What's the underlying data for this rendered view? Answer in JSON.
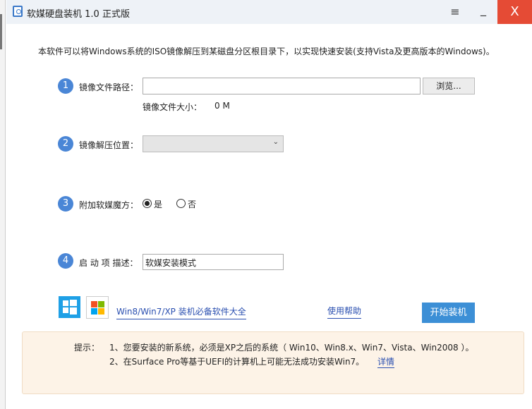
{
  "window": {
    "title": "软媒硬盘装机 1.0 正式版",
    "menu_icon": "hamburger-icon",
    "minimize_icon": "minimize-icon",
    "close_icon": "close-icon",
    "menu_glyph": "≡",
    "min_glyph": "_",
    "close_glyph": "X"
  },
  "intro": "本软件可以将Windows系统的ISO镜像解压到某磁盘分区根目录下，以实现快速安装(支持Vista及更高版本的Windows)。",
  "steps": [
    {
      "num": "1",
      "label": "镜像文件路径：",
      "value": "",
      "button": "浏览...",
      "size_label": "镜像文件大小：",
      "size_value": "0 M"
    },
    {
      "num": "2",
      "label": "镜像解压位置：",
      "value": ""
    },
    {
      "num": "3",
      "label": "附加软媒魔方：",
      "opt_yes": "是",
      "opt_no": "否",
      "selected": "是"
    },
    {
      "num": "4",
      "label": "启 动 项 描述：",
      "value": "软媒安装模式"
    }
  ],
  "links": {
    "software": "Win8/Win7/XP 装机必备软件大全",
    "help": "使用帮助"
  },
  "start_button": "开始装机",
  "tips": {
    "label": "提示：",
    "line1": "1、您要安装的新系统，必须是XP之后的系统（ Win10、Win8.x、Win7、Vista、Win2008 ）。",
    "line2": "2、在Surface Pro等基于UEFI的计算机上可能无法成功安装Win7。",
    "details": "详情"
  },
  "colors": {
    "accent": "#3c8fd6",
    "close": "#e54b35",
    "tip_bg": "#fdf3e7"
  }
}
